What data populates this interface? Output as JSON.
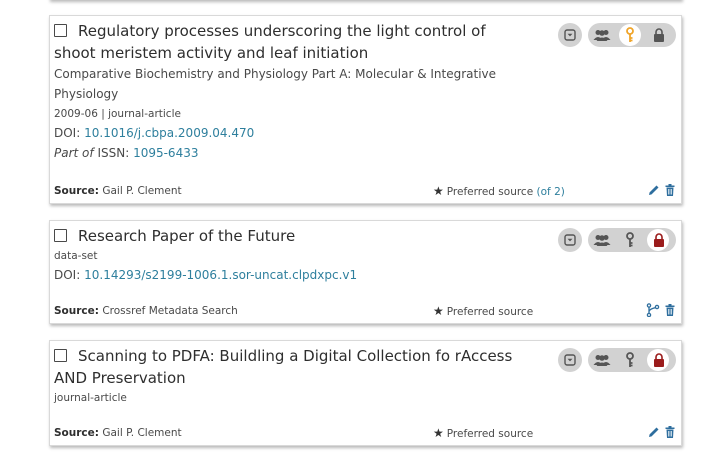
{
  "colors": {
    "link": "#2e7f9d",
    "gold": "#f0a52a",
    "red": "#9b1c1c",
    "gray_icon": "#555555",
    "action_blue": "#2e6e9e"
  },
  "cards": [
    {
      "title_line1": "Regulatory processes underscoring the light control of",
      "title_line2": "shoot meristem activity and leaf initiation",
      "journal_line1": "Comparative Biochemistry and Physiology Part A: Molecular & Integrative",
      "journal_line2": "Physiology",
      "date_type": "2009-06 | journal-article",
      "doi_label": "DOI:",
      "doi_value": "10.1016/j.cbpa.2009.04.470",
      "partof_label": "Part of",
      "issn_label": "ISSN:",
      "issn_value": "1095-6433",
      "source_label": "Source:",
      "source_value": "Gail P. Clement",
      "preferred": "Preferred source",
      "preferred_suffix_open": "(",
      "preferred_of": "of 2",
      "preferred_suffix_close": ")",
      "privacy": "limited"
    },
    {
      "title_line1": "Research Paper of the Future",
      "type": "data-set",
      "doi_label": "DOI:",
      "doi_value": "10.14293/s2199-1006.1.sor-uncat.clpdxpc.v1",
      "source_label": "Source:",
      "source_value": "Crossref Metadata Search",
      "preferred": "Preferred source",
      "privacy": "private"
    },
    {
      "title_line1": "Scanning to PDFA: Buildling a Digital Collection fo rAccess",
      "title_line2": "AND Preservation",
      "type": "journal-article",
      "source_label": "Source:",
      "source_value": "Gail P. Clement",
      "preferred": "Preferred source",
      "privacy": "private"
    }
  ],
  "icons": {
    "expand": "chevron-down-icon",
    "everyone": "group-icon",
    "limited": "key-icon",
    "private": "lock-icon",
    "edit": "pencil-icon",
    "delete": "trash-icon",
    "combine": "branch-icon",
    "star": "star-icon"
  }
}
